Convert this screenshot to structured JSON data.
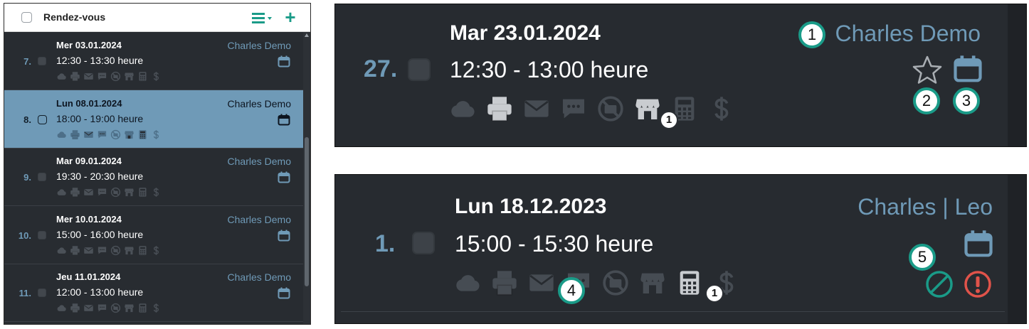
{
  "list": {
    "header": {
      "title": "Rendez-vous",
      "menu_icon": "list-filter-icon",
      "add_icon": "plus-icon"
    },
    "rows": [
      {
        "num": "7.",
        "date": "Mer 03.01.2024",
        "time": "12:30 - 13:30 heure",
        "who": "Charles Demo",
        "selected": false
      },
      {
        "num": "8.",
        "date": "Lun 08.01.2024",
        "time": "18:00 - 19:00 heure",
        "who": "Charles Demo",
        "selected": true
      },
      {
        "num": "9.",
        "date": "Mar 09.01.2024",
        "time": "19:30 - 20:30 heure",
        "who": "Charles Demo",
        "selected": false
      },
      {
        "num": "10.",
        "date": "Mer 10.01.2024",
        "time": "15:00 - 16:00 heure",
        "who": "Charles Demo",
        "selected": false
      },
      {
        "num": "11.",
        "date": "Jeu 11.01.2024",
        "time": "12:00 - 13:00 heure",
        "who": "Charles Demo",
        "selected": false
      }
    ],
    "row_icons": [
      "cloud-icon",
      "printer-icon",
      "envelope-icon",
      "chat-icon",
      "no-camera-icon",
      "store-icon",
      "calculator-icon",
      "dollar-icon"
    ]
  },
  "zoom_a": {
    "num": "27.",
    "date": "Mar 23.01.2024",
    "time": "12:30 - 13:00 heure",
    "who": "Charles Demo",
    "store_badge": "1",
    "callouts": [
      "1",
      "2",
      "3"
    ]
  },
  "zoom_b": {
    "num": "1.",
    "date": "Lun 18.12.2023",
    "time": "15:00 - 15:30 heure",
    "who": "Charles | Leo",
    "calc_badge": "1",
    "callouts": [
      "4",
      "5"
    ]
  },
  "colors": {
    "accent": "#1a9b88",
    "blue": "#6f9ab7",
    "danger": "#e0534a",
    "bg": "#272b30"
  }
}
